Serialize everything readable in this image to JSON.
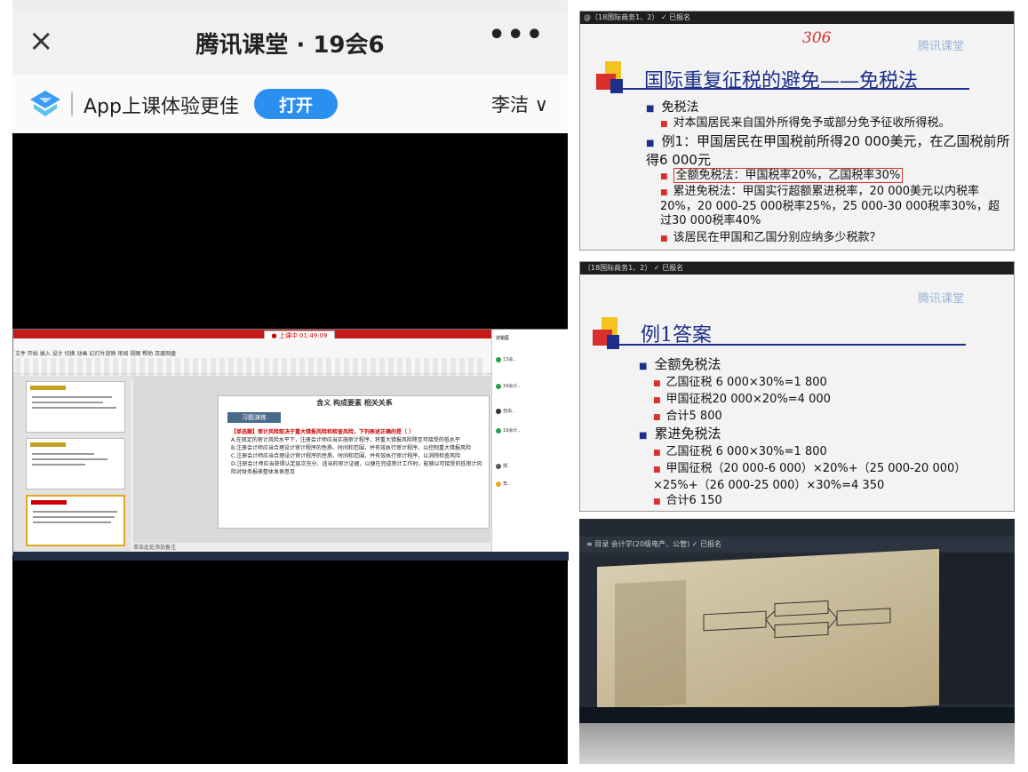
{
  "phone": {
    "title": "腾讯课堂 · 19会6",
    "close_icon": "×",
    "more_icon": "•••",
    "app_banner_text": "App上课体验更佳",
    "open_button": "打开",
    "user_name": "李洁 ∨"
  },
  "ppt_screenshot": {
    "rec_label": "● 上课中 01:49:09",
    "menu": "文件  开始  插入  设计  切换  动画  幻灯片放映  审阅  视图  帮助  百度网盘",
    "slide_header": "含义        构成要素      相关关系",
    "slide_tab": "习题演练",
    "question_title": "【单选题】审计风险取决于重大错报风险和检查风险，下列表述正确的是（ ）",
    "options": [
      "A.在既定的审计风险水平下，注册会计师应当实施审计程序，将重大错报风险降至可接受的低水平",
      "B.注册会计师应当合理设计审计程序的性质、时间和范围，并有效执行审计程序，以控制重大错报风险",
      "C.注册会计师应当合理设计审计程序的性质、时间和范围，并有效执行审计程序，以消除检查风险",
      "D.注册会计师应当获得认定层次充分、适当的审计证据，以便在完成审计工作时，能够以可接受的低审计风险对财务报表整体发表意见"
    ],
    "notes": "单击此处添加备注",
    "side_list": [
      "讨论区",
      "13会..",
      "19会计..",
      "自由..",
      "19会计..",
      "郭..",
      "李.."
    ]
  },
  "slide1": {
    "bar_text": "@（18国际商务1、2）  ✓ 已报名",
    "handwritten": "306",
    "logo": "腾讯课堂",
    "title": "国际重复征税的避免——免税法",
    "items": [
      {
        "level": 1,
        "text": "免税法"
      },
      {
        "level": 2,
        "text": "对本国居民来自国外所得免予或部分免予征收所得税。"
      },
      {
        "level": 1,
        "text": "例1：甲国居民在甲国税前所得20 000美元，在乙国税前所得6 000元"
      },
      {
        "level": 2,
        "text": "全额免税法：甲国税率20%，乙国税率30%"
      },
      {
        "level": 2,
        "text": "累进免税法：甲国实行超额累进税率，20 000美元以内税率20%，20 000-25 000税率25%，25 000-30 000税率30%，超过30 000税率40%"
      },
      {
        "level": 2,
        "text": "该居民在甲国和乙国分别应纳多少税款？"
      }
    ]
  },
  "slide2": {
    "bar_text": "（18国际商务1、2）  ✓ 已报名",
    "logo": "腾讯课堂",
    "title": "例1答案",
    "items": [
      {
        "level": 1,
        "text": "全额免税法"
      },
      {
        "level": 2,
        "text": "乙国征税 6 000×30%=1 800"
      },
      {
        "level": 2,
        "text": "甲国征税20 000×20%=4 000"
      },
      {
        "level": 2,
        "text": "合计5 800"
      },
      {
        "level": 1,
        "text": "累进免税法"
      },
      {
        "level": 2,
        "text": "乙国征税 6 000×30%=1 800"
      },
      {
        "level": 2,
        "text": "甲国征税（20 000-6 000）×20%+（25 000-20 000）×25%+（26 000-25 000）×30%=4 350"
      },
      {
        "level": 2,
        "text": "合计6 150"
      }
    ]
  },
  "photo": {
    "top_bar": "≡ 目录   会计学(20级电产、公管)   ✓ 已报名"
  }
}
